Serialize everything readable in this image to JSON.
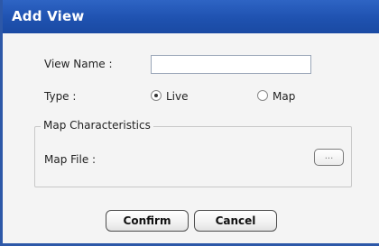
{
  "window": {
    "title": "Add View"
  },
  "form": {
    "view_name_label": "View Name :",
    "view_name_value": "",
    "type_label": "Type :",
    "type_options": [
      {
        "label": "Live",
        "selected": true
      },
      {
        "label": "Map",
        "selected": false
      }
    ]
  },
  "map_characteristics": {
    "legend": "Map Characteristics",
    "map_file_label": "Map File :",
    "browse_label": "..."
  },
  "actions": {
    "confirm_label": "Confirm",
    "cancel_label": "Cancel"
  },
  "colors": {
    "titlebar": "#1f52b0",
    "frame_border": "#2d58a8",
    "dialog_bg": "#f4f4f4"
  }
}
